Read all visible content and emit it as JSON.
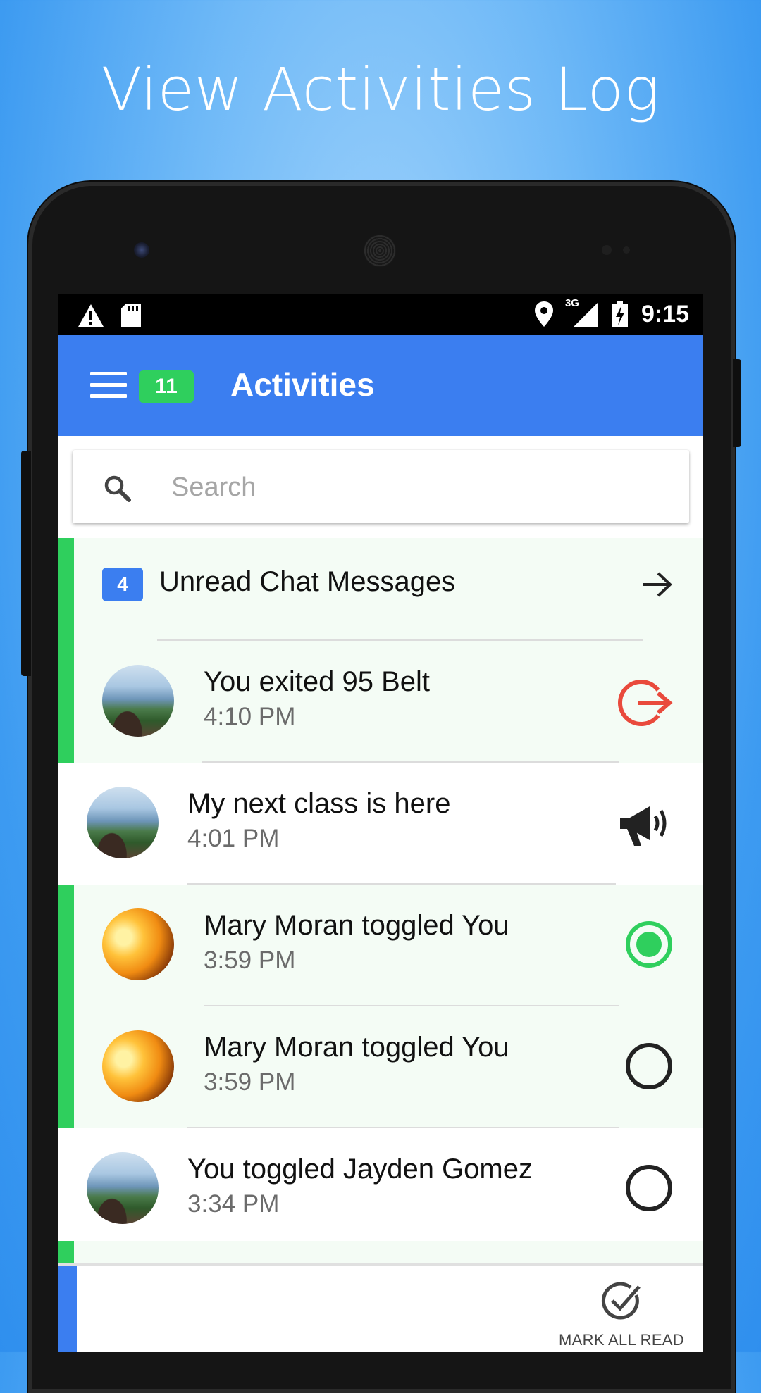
{
  "promo": {
    "headline": "View Activities Log"
  },
  "status_bar": {
    "time": "9:15",
    "network": "3G"
  },
  "app_bar": {
    "title": "Activities",
    "unread_count": "11"
  },
  "search": {
    "placeholder": "Search",
    "value": ""
  },
  "chat_summary": {
    "count": "4",
    "label": "Unread Chat Messages"
  },
  "activities": [
    {
      "title": "You exited 95 Belt",
      "time": "4:10 PM",
      "unread": true,
      "avatar": "beach",
      "icon": "exit-icon"
    },
    {
      "title": "My next class is here",
      "time": "4:01 PM",
      "unread": false,
      "avatar": "beach",
      "icon": "megaphone-icon"
    },
    {
      "title": "Mary Moran toggled You",
      "time": "3:59 PM",
      "unread": true,
      "avatar": "sunset",
      "icon": "radio-checked-icon"
    },
    {
      "title": "Mary Moran toggled You",
      "time": "3:59 PM",
      "unread": true,
      "avatar": "sunset",
      "icon": "radio-unchecked-icon"
    },
    {
      "title": "You toggled Jayden Gomez",
      "time": "3:34 PM",
      "unread": false,
      "avatar": "beach",
      "icon": "radio-unchecked-icon"
    }
  ],
  "footer": {
    "mark_all_read": "MARK ALL READ"
  },
  "colors": {
    "primary": "#3b7ef0",
    "accent_green": "#2fcf5d",
    "exit_red": "#e94a3c"
  }
}
